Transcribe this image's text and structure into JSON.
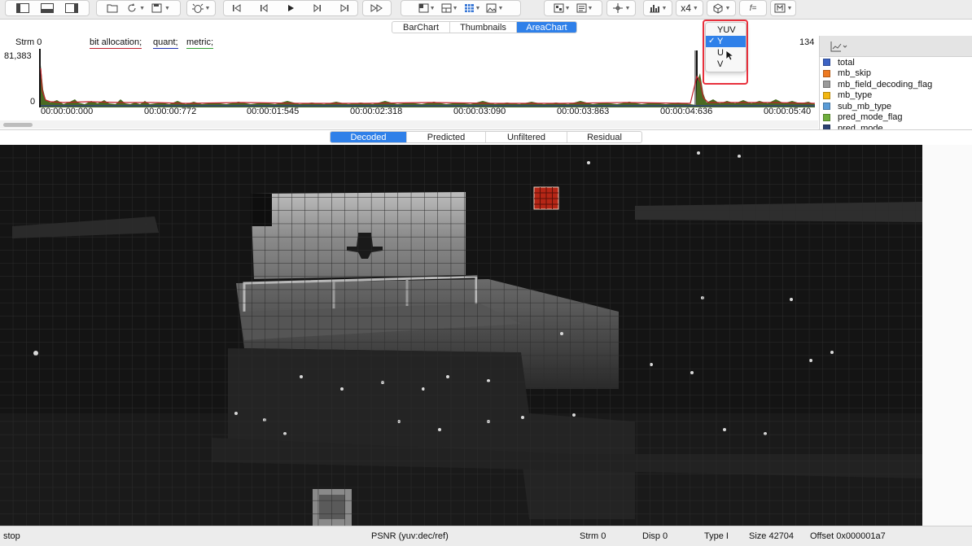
{
  "toolbar": {
    "zoom_label": "x4",
    "func_label": "f=",
    "buttons": [
      "sidebar-left-icon",
      "panel-bottom-icon",
      "sidebar-right-icon",
      "folder-icon",
      "reload-icon",
      "save-icon",
      "bug-icon",
      "skip-start-icon",
      "step-back-icon",
      "play-icon",
      "step-forward-icon",
      "skip-end-icon",
      "fast-forward-icon",
      "grid-icon",
      "layout-icon",
      "table-icon",
      "image-icon",
      "block-icon",
      "doc-icon",
      "move-icon",
      "histogram-icon",
      "cube-icon",
      "function-icon",
      "merge-icon"
    ]
  },
  "top_tabs": [
    {
      "label": "BarChart",
      "active": false
    },
    {
      "label": "Thumbnails",
      "active": false
    },
    {
      "label": "AreaChart",
      "active": true
    }
  ],
  "chart": {
    "stream_label": "Strm 0",
    "series_labels": [
      {
        "name": "bit allocation;",
        "color": "#c0202a"
      },
      {
        "name": "quant;",
        "color": "#2030b0"
      },
      {
        "name": "metric;",
        "color": "#30a030"
      }
    ],
    "y_max_label": "81,383",
    "y_min_label": "0",
    "right_count": "134",
    "time_ticks": [
      "00:00:00:000",
      "00:00:00:772",
      "00:00:01:545",
      "00:00:02:318",
      "00:00:03:090",
      "00:00:03:863",
      "00:00:04:636",
      "00:00:05:40"
    ]
  },
  "legend": {
    "header_icon": "line-chart-icon",
    "items": [
      {
        "label": "total",
        "color": "#3d63c4"
      },
      {
        "label": "mb_skip",
        "color": "#ee7a22"
      },
      {
        "label": "mb_field_decoding_flag",
        "color": "#9a9a9a"
      },
      {
        "label": "mb_type",
        "color": "#f2b611"
      },
      {
        "label": "sub_mb_type",
        "color": "#5a9bd6"
      },
      {
        "label": "pred_mode_flag",
        "color": "#6fae3d"
      },
      {
        "label": "pred_mode",
        "color": "#2b4172"
      }
    ]
  },
  "view_tabs": [
    {
      "label": "Decoded",
      "active": true
    },
    {
      "label": "Predicted",
      "active": false
    },
    {
      "label": "Unfiltered",
      "active": false
    },
    {
      "label": "Residual",
      "active": false
    }
  ],
  "dropdown": {
    "items": [
      {
        "label": "YUV",
        "selected": false
      },
      {
        "label": "Y",
        "selected": true
      },
      {
        "label": "U",
        "selected": false
      },
      {
        "label": "V",
        "selected": false
      }
    ]
  },
  "status": {
    "state": "stop",
    "psnr": "PSNR (yuv:dec/ref)",
    "stream": "Strm 0",
    "disp": "Disp 0",
    "type": "Type I",
    "size": "Size 42704",
    "offset": "Offset 0x000001a7"
  },
  "colors": {
    "accent": "#2f80e9",
    "highlight": "#e8303c",
    "selected_block": "#b52616"
  }
}
